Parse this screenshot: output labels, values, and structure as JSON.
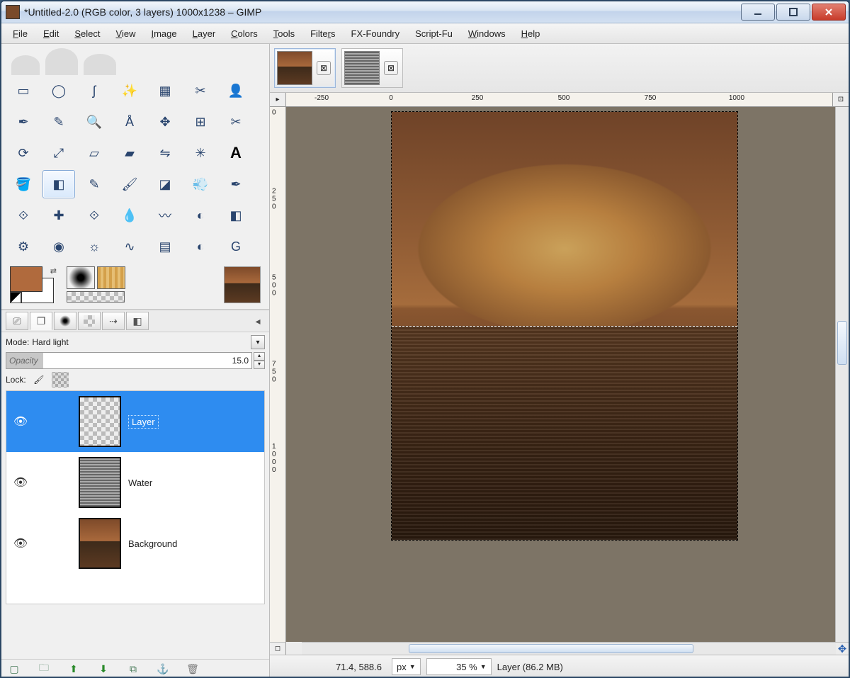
{
  "window": {
    "title": "*Untitled-2.0 (RGB color, 3 layers) 1000x1238 – GIMP"
  },
  "menu": {
    "file": "File",
    "edit": "Edit",
    "select": "Select",
    "view": "View",
    "image": "Image",
    "layer": "Layer",
    "colors": "Colors",
    "tools": "Tools",
    "filters": "Filters",
    "fxfoundry": "FX-Foundry",
    "scriptfu": "Script-Fu",
    "windows": "Windows",
    "help": "Help"
  },
  "toolbox": {
    "tools": [
      "rect-select",
      "ellipse-select",
      "free-select",
      "fuzzy-select",
      "by-color-select",
      "scissors",
      "foreground-select",
      "paths",
      "color-picker",
      "zoom",
      "measure",
      "move",
      "align",
      "crop",
      "rotate",
      "scale",
      "shear",
      "perspective",
      "flip",
      "cage",
      "text",
      "bucket-fill",
      "blend",
      "pencil",
      "paintbrush",
      "eraser",
      "airbrush",
      "ink",
      "clone",
      "heal",
      "perspective-clone",
      "blur",
      "smudge",
      "dodge",
      "color-balance",
      "hue-saturation",
      "colorize",
      "brightness",
      "curves",
      "posterize",
      "desaturate",
      "gegl"
    ],
    "fg_color": "#b06a3d",
    "bg_color": "#ffffff"
  },
  "layers": {
    "mode_label": "Mode:",
    "mode_value": "Hard light",
    "opacity_label": "Opacity",
    "opacity_value": "15.0",
    "lock_label": "Lock:",
    "items": [
      {
        "name": "Layer",
        "visible": true,
        "selected": true,
        "thumb": "check"
      },
      {
        "name": "Water",
        "visible": true,
        "selected": false,
        "thumb": "water"
      },
      {
        "name": "Background",
        "visible": true,
        "selected": false,
        "thumb": "bg"
      }
    ]
  },
  "tabs": [
    {
      "name": "lizard-image",
      "thumb": "liz",
      "active": true
    },
    {
      "name": "water-image",
      "thumb": "water",
      "active": false
    }
  ],
  "ruler": {
    "h": [
      "-250",
      "0",
      "250",
      "500",
      "750",
      "1000"
    ],
    "v": [
      "0",
      "250",
      "500",
      "750",
      "1000"
    ]
  },
  "status": {
    "coords": "71.4, 588.6",
    "unit": "px",
    "zoom": "35 %",
    "layer_info": "Layer (86.2 MB)"
  }
}
